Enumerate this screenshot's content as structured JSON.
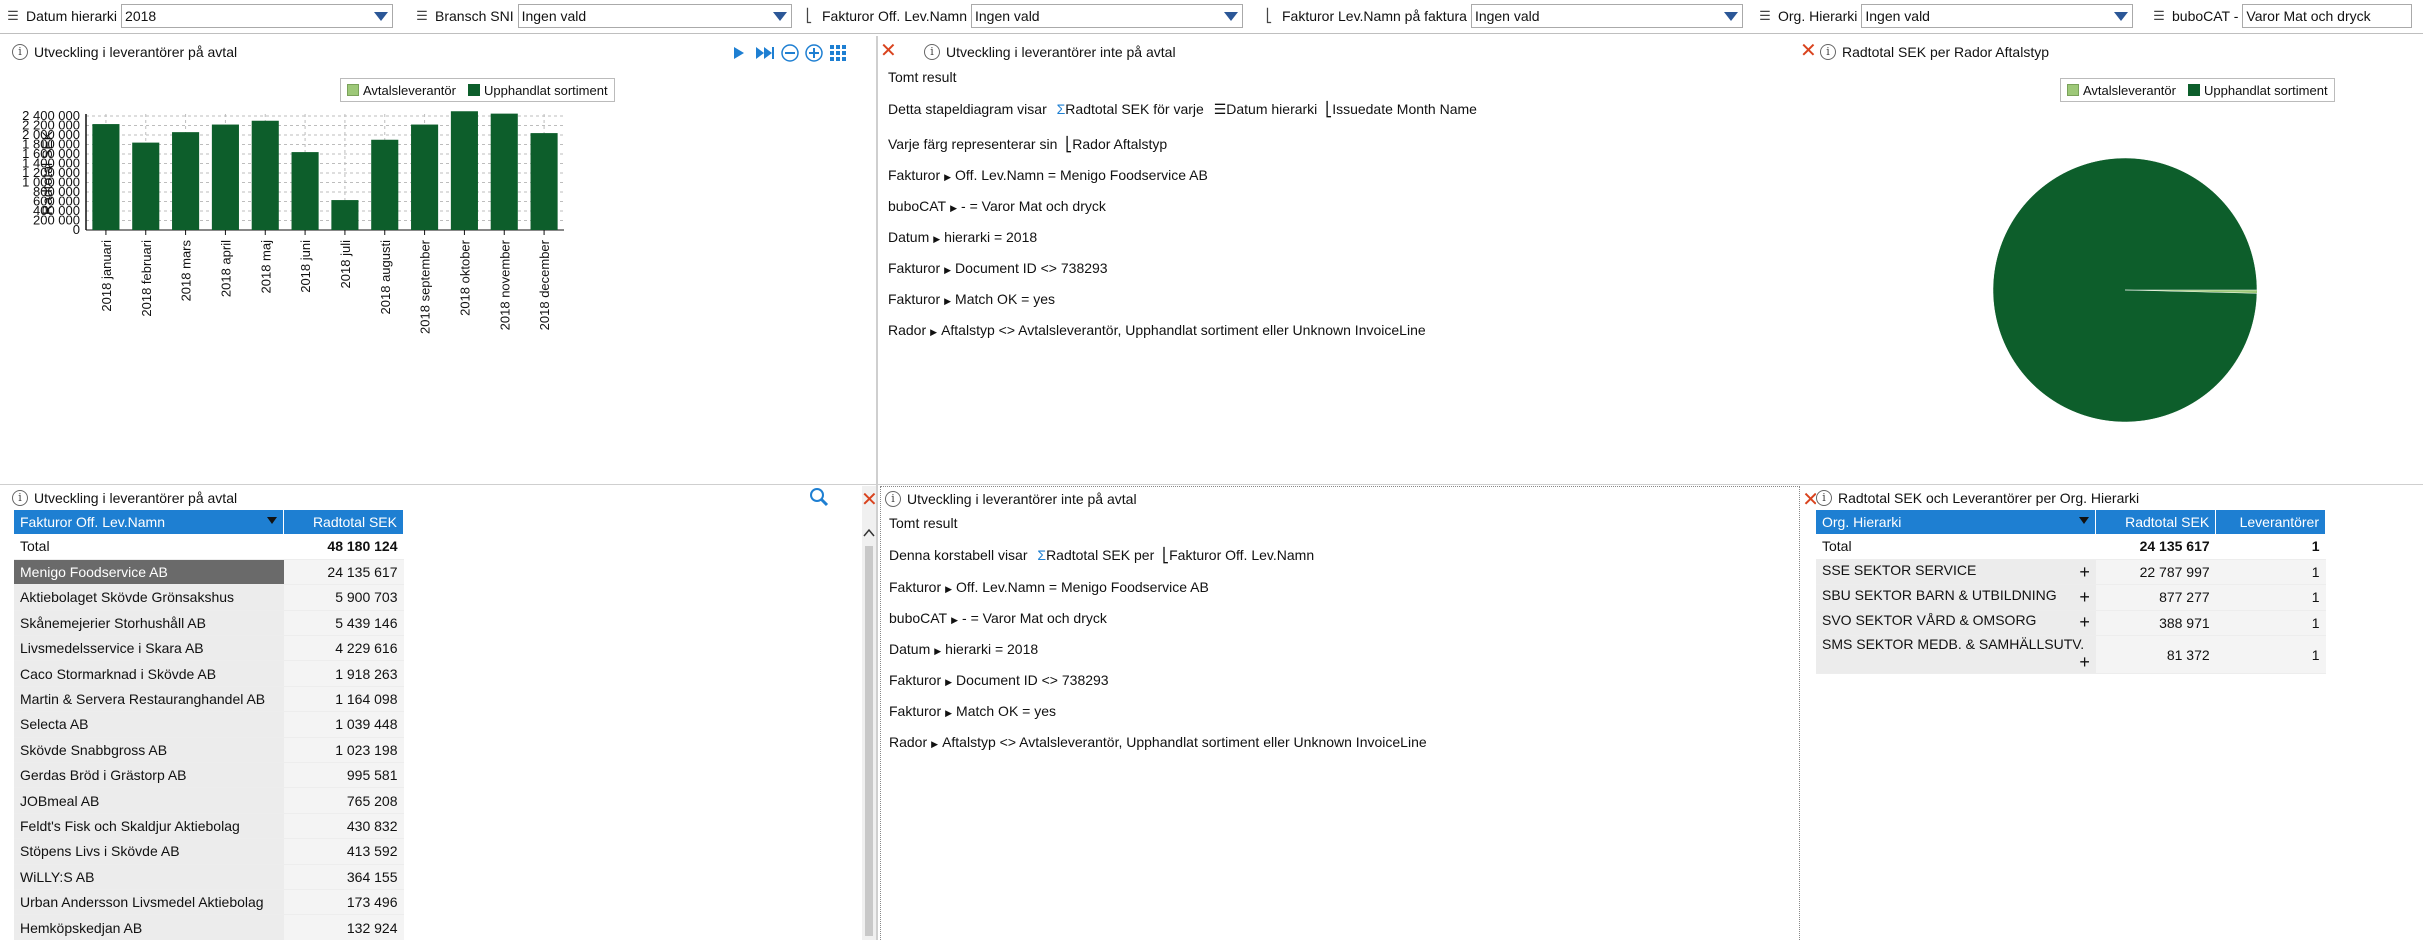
{
  "filters": [
    {
      "label": "Datum hierarki",
      "value": "2018",
      "icon": "hierarchy-icon"
    },
    {
      "label": "Bransch SNI",
      "value": "Ingen vald",
      "icon": "hierarchy-icon"
    },
    {
      "label": "Fakturor Off. Lev.Namn",
      "value": "Ingen vald",
      "icon": "column-icon"
    },
    {
      "label": "Fakturor Lev.Namn på faktura",
      "value": "Ingen vald",
      "icon": "column-icon"
    },
    {
      "label": "Org. Hierarki",
      "value": "Ingen vald",
      "icon": "hierarchy-icon"
    },
    {
      "label": "buboCAT -",
      "value": "Varor Mat och dryck",
      "icon": "hierarchy-icon"
    }
  ],
  "panel_bar": {
    "title": "Utveckling i leverantörer på avtal",
    "legend": [
      "Avtalsleverantör",
      "Upphandlat sortiment"
    ]
  },
  "panel_empty1": {
    "title": "Utveckling i leverantörer inte på avtal",
    "result": "Tomt result",
    "desc_prefix": "Detta stapeldiagram visar",
    "desc_measure": "Radtotal SEK för varje",
    "desc_dim1": "Datum hierarki",
    "desc_dim2": "Issuedate Month Name",
    "color_prefix": "Varje färg representerar sin",
    "color_dim": "Rador Aftalstyp",
    "conditions": [
      [
        "Fakturor",
        "Off. Lev.Namn = Menigo Foodservice AB"
      ],
      [
        "buboCAT",
        "- = Varor Mat och dryck"
      ],
      [
        "Datum",
        "hierarki = 2018"
      ],
      [
        "Fakturor",
        "Document ID <> 738293"
      ],
      [
        "Fakturor",
        "Match OK = yes"
      ],
      [
        "Rador",
        "Aftalstyp <> Avtalsleverantör, Upphandlat sortiment eller Unknown InvoiceLine"
      ]
    ]
  },
  "panel_pie": {
    "title": "Radtotal SEK per Rador Aftalstyp",
    "legend": [
      "Avtalsleverantör",
      "Upphandlat sortiment"
    ]
  },
  "panel_table1": {
    "title": "Utveckling i leverantörer på avtal",
    "col1": "Fakturor Off. Lev.Namn",
    "col2": "Radtotal SEK",
    "total_label": "Total",
    "total_value": "48 180 124",
    "rows": [
      {
        "name": "Menigo Foodservice AB",
        "value": "24 135 617"
      },
      {
        "name": "Aktiebolaget Skövde Grönsakshus",
        "value": "5 900 703"
      },
      {
        "name": "Skånemejerier Storhushåll AB",
        "value": "5 439 146"
      },
      {
        "name": "Livsmedelsservice i Skara AB",
        "value": "4 229 616"
      },
      {
        "name": "Caco Stormarknad i Skövde AB",
        "value": "1 918 263"
      },
      {
        "name": "Martin & Servera Restauranghandel AB",
        "value": "1 164 098"
      },
      {
        "name": "Selecta AB",
        "value": "1 039 448"
      },
      {
        "name": "Skövde Snabbgross AB",
        "value": "1 023 198"
      },
      {
        "name": "Gerdas Bröd i Grästorp AB",
        "value": "995 581"
      },
      {
        "name": "JOBmeal AB",
        "value": "765 208"
      },
      {
        "name": "Feldt's Fisk och Skaldjur Aktiebolag",
        "value": "430 832"
      },
      {
        "name": "Stöpens Livs i Skövde AB",
        "value": "413 592"
      },
      {
        "name": "WiLLY:S AB",
        "value": "364 155"
      },
      {
        "name": "Urban Andersson Livsmedel Aktiebolag",
        "value": "173 496"
      },
      {
        "name": "Hemköpskedjan AB",
        "value": "132 924"
      }
    ]
  },
  "panel_empty2": {
    "title": "Utveckling i leverantörer inte på avtal",
    "result": "Tomt result",
    "desc_prefix": "Denna korstabell visar",
    "desc_measure": "Radtotal SEK per",
    "desc_dim": "Fakturor Off. Lev.Namn",
    "conditions": [
      [
        "Fakturor",
        "Off. Lev.Namn = Menigo Foodservice AB"
      ],
      [
        "buboCAT",
        "- = Varor Mat och dryck"
      ],
      [
        "Datum",
        "hierarki = 2018"
      ],
      [
        "Fakturor",
        "Document ID <> 738293"
      ],
      [
        "Fakturor",
        "Match OK = yes"
      ],
      [
        "Rador",
        "Aftalstyp <> Avtalsleverantör, Upphandlat sortiment eller Unknown InvoiceLine"
      ]
    ]
  },
  "panel_table2": {
    "title": "Radtotal SEK och Leverantörer per Org. Hierarki",
    "col1": "Org.  Hierarki",
    "col2": "Radtotal SEK",
    "col3": "Leverantörer",
    "total_label": "Total",
    "total_value": "24 135 617",
    "total_count": "1",
    "rows": [
      {
        "name": "SSE SEKTOR SERVICE",
        "value": "22 787 997",
        "count": "1"
      },
      {
        "name": "SBU SEKTOR BARN & UTBILDNING",
        "value": "877 277",
        "count": "1"
      },
      {
        "name": "SVO SEKTOR VÅRD & OMSORG",
        "value": "388 971",
        "count": "1"
      },
      {
        "name": "SMS SEKTOR MEDB. & SAMHÄLLSUTV.",
        "value": "81 372",
        "count": "1"
      }
    ]
  },
  "colors": {
    "avtal": "#9dc878",
    "upphandlat": "#0d5e2b",
    "header_blue": "#1e7fd2",
    "close_red": "#d9431e"
  },
  "chart_data": [
    {
      "type": "bar",
      "categories": [
        "2018 januari",
        "2018 februari",
        "2018 mars",
        "2018 april",
        "2018 maj",
        "2018 juni",
        "2018 juli",
        "2018 augusti",
        "2018 september",
        "2018 oktober",
        "2018 november",
        "2018 december"
      ],
      "series": [
        {
          "name": "Upphandlat sortiment",
          "values": [
            2230000,
            1840000,
            2060000,
            2220000,
            2300000,
            1640000,
            630000,
            1900000,
            2220000,
            2500000,
            2450000,
            2040000
          ]
        }
      ],
      "ylabel": "Radtotal SEK",
      "ylim": [
        0,
        2400000
      ],
      "yticks": [
        0,
        200000,
        400000,
        600000,
        800000,
        1000000,
        1200000,
        1400000,
        1600000,
        1800000,
        2000000,
        2200000,
        2400000
      ],
      "ytick_labels": [
        "0",
        "200 000",
        "400 000",
        "600 000",
        "800 000",
        "1 000 000",
        "1 200 000",
        "1 400 000",
        "1 600 000",
        "1 800 000",
        "2 000 000",
        "2 200 000",
        "2 400 000"
      ],
      "legend": [
        "Avtalsleverantör",
        "Upphandlat sortiment"
      ],
      "grid": true
    },
    {
      "type": "pie",
      "categories": [
        "Avtalsleverantör",
        "Upphandlat sortiment"
      ],
      "values": [
        0.4,
        99.6
      ],
      "legend": [
        "Avtalsleverantör",
        "Upphandlat sortiment"
      ]
    }
  ]
}
